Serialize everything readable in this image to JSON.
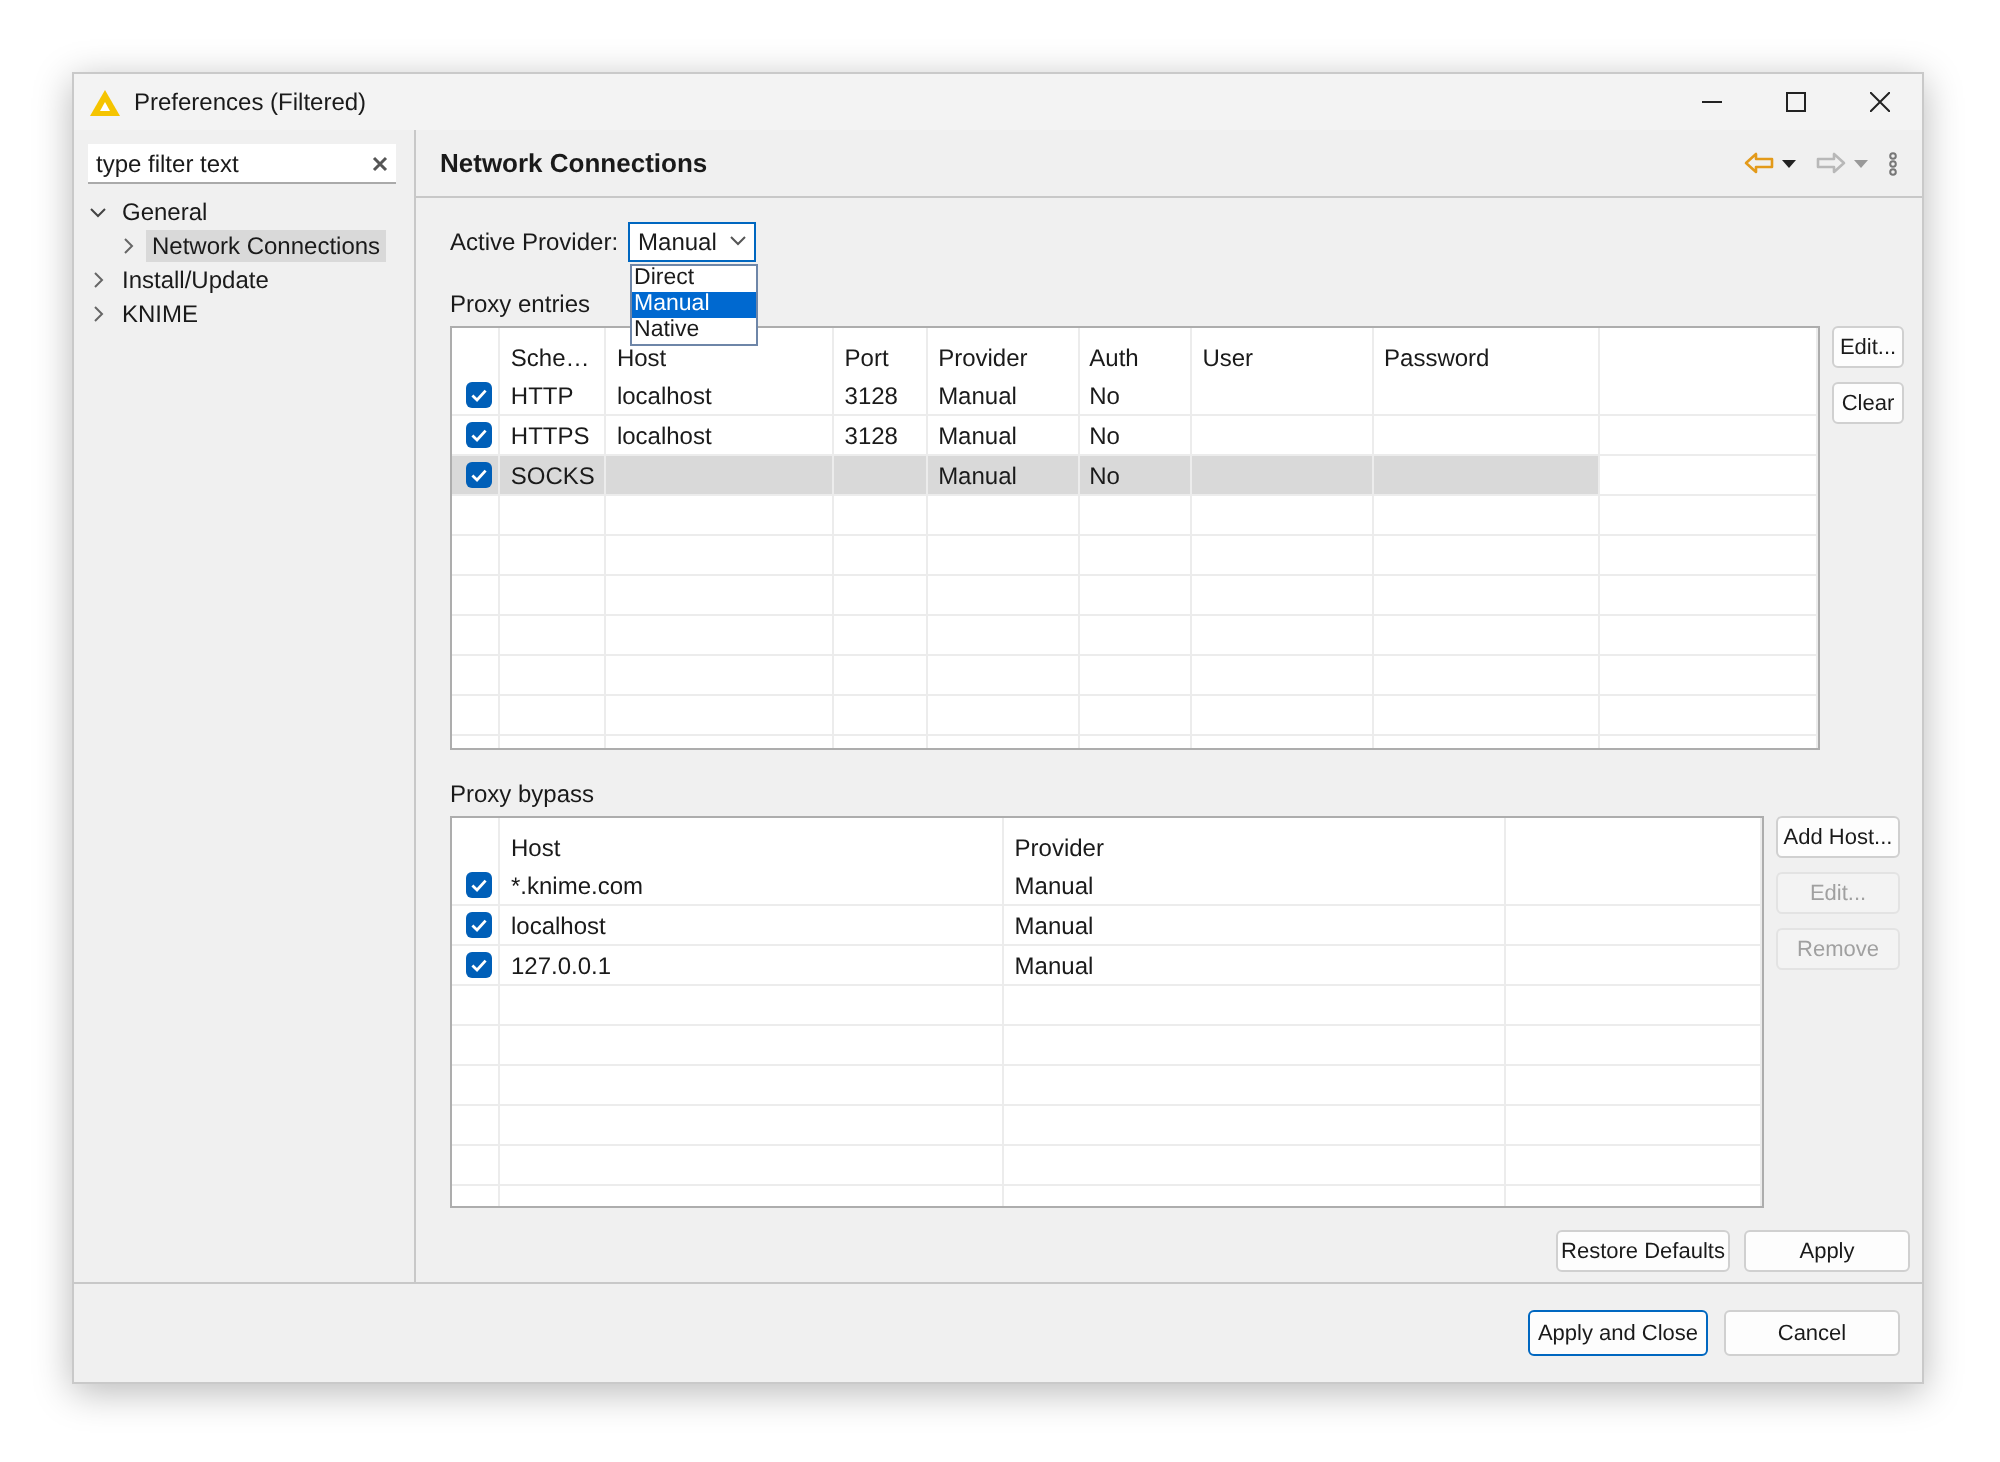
{
  "window": {
    "title": "Preferences (Filtered)"
  },
  "sidebar": {
    "filter": {
      "value": "type filter text"
    },
    "tree": [
      {
        "label": "General",
        "expanded": true,
        "selected": false,
        "children": [
          {
            "label": "Network Connections",
            "expanded": false,
            "selected": true
          }
        ]
      },
      {
        "label": "Install/Update",
        "expanded": false,
        "selected": false
      },
      {
        "label": "KNIME",
        "expanded": false,
        "selected": false
      }
    ]
  },
  "page": {
    "title": "Network Connections",
    "navigation": {
      "back": {
        "disabled": false
      },
      "forward": {
        "disabled": true
      }
    },
    "active_provider": {
      "label": "Active Provider:",
      "value": "Manual",
      "open": true,
      "options": [
        {
          "label": "Direct",
          "selected": false
        },
        {
          "label": "Manual",
          "selected": true
        },
        {
          "label": "Native",
          "selected": false
        }
      ]
    },
    "proxy_entries": {
      "label": "Proxy entries",
      "columns": [
        "Sche…",
        "Host",
        "Port",
        "Provider",
        "Auth",
        "User",
        "Password"
      ],
      "rows": [
        {
          "checked": true,
          "selected": false,
          "scheme": "HTTP",
          "host": "localhost",
          "port": "3128",
          "provider": "Manual",
          "auth": "No"
        },
        {
          "checked": true,
          "selected": false,
          "scheme": "HTTPS",
          "host": "localhost",
          "port": "3128",
          "provider": "Manual",
          "auth": "No"
        },
        {
          "checked": true,
          "selected": true,
          "scheme": "SOCKS",
          "provider": "Manual",
          "auth": "No"
        }
      ],
      "buttons": [
        {
          "label": "Edit...",
          "disabled": false
        },
        {
          "label": "Clear",
          "disabled": false
        }
      ]
    },
    "proxy_bypass": {
      "label": "Proxy bypass",
      "columns": [
        "Host",
        "Provider"
      ],
      "rows": [
        {
          "checked": true,
          "host": "*.knime.com",
          "provider": "Manual"
        },
        {
          "checked": true,
          "host": "localhost",
          "provider": "Manual"
        },
        {
          "checked": true,
          "host": "127.0.0.1",
          "provider": "Manual"
        }
      ],
      "buttons": [
        {
          "label": "Add Host...",
          "disabled": false
        },
        {
          "label": "Edit...",
          "disabled": true
        },
        {
          "label": "Remove",
          "disabled": true
        }
      ]
    },
    "page_buttons": [
      {
        "label": "Restore Defaults"
      },
      {
        "label": "Apply"
      }
    ]
  },
  "dialog_buttons": [
    {
      "label": "Apply and Close",
      "default": true
    },
    {
      "label": "Cancel",
      "default": false
    }
  ]
}
